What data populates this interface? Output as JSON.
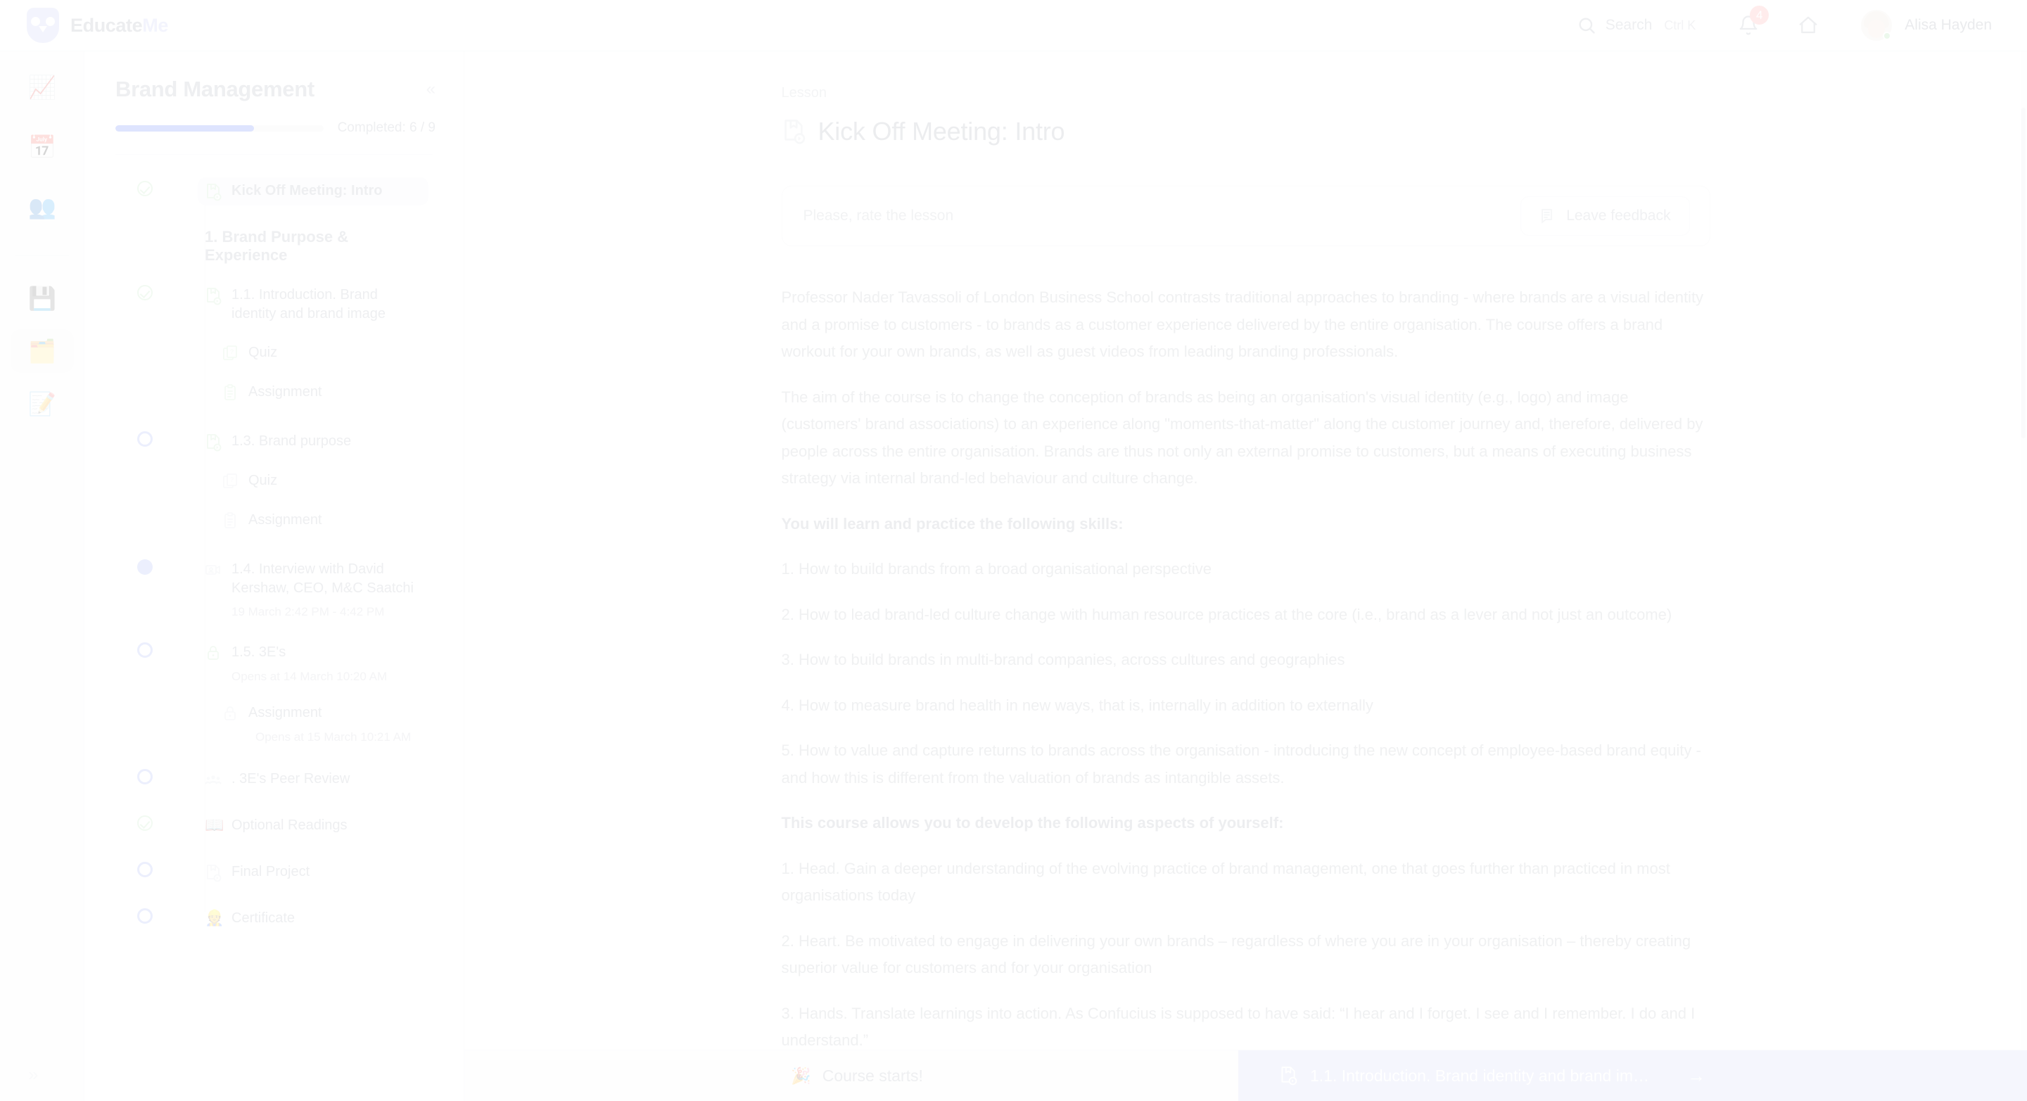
{
  "header": {
    "brand_first": "Educate",
    "brand_second": "Me",
    "brand_icon": "owl-logo",
    "search_label": "Search",
    "search_shortcut": "Ctrl K",
    "search_icon": "search-icon",
    "notifications_icon": "bell-icon",
    "notifications_count": "4",
    "home_icon": "home-icon",
    "user_name": "Alisa Hayden",
    "avatar_icon": "avatar",
    "online_status": "online"
  },
  "rail": {
    "expand_icon": "chevron-double-right-icon",
    "items": [
      {
        "name": "analytics",
        "icon": "chart-increasing-icon",
        "glyph": "📈",
        "selected": false
      },
      {
        "name": "calendar",
        "icon": "calendar-icon",
        "glyph": "📅",
        "selected": false
      },
      {
        "name": "people",
        "icon": "people-icon",
        "glyph": "👥",
        "selected": false
      },
      {
        "name": "saved",
        "icon": "floppy-disk-icon",
        "glyph": "💾",
        "selected": false
      },
      {
        "name": "courses",
        "icon": "card-index-dividers-icon",
        "glyph": "🗂️",
        "selected": true
      },
      {
        "name": "notes",
        "icon": "memo-icon",
        "glyph": "📝",
        "selected": false
      }
    ]
  },
  "course": {
    "title": "Brand Management",
    "collapse_icon": "chevron-double-left-icon",
    "progress_label": "Completed: 6 / 9",
    "progress_completed": 6,
    "progress_total": 9,
    "progress_percent": 66.6,
    "progress_color": "#3b5bfd",
    "items": [
      {
        "label": "Kick Off Meeting: Intro",
        "icon": "lesson-video-icon",
        "marker": "done",
        "active": true,
        "bold": true,
        "sub": "",
        "indent": false
      },
      {
        "label": "1. Brand Purpose & Experience",
        "icon": "none",
        "marker": "none",
        "active": false,
        "bold": true,
        "sub": "",
        "indent": false,
        "section": true
      },
      {
        "label": "1.1. Introduction. Brand identity and brand image",
        "icon": "lesson-video-icon",
        "marker": "done",
        "active": false,
        "bold": false,
        "sub": "",
        "indent": false
      },
      {
        "label": "Quiz",
        "icon": "quiz-icon",
        "marker": "none",
        "active": false,
        "bold": false,
        "sub": "",
        "indent": true
      },
      {
        "label": "Assignment",
        "icon": "assignment-icon",
        "marker": "none",
        "active": false,
        "bold": false,
        "sub": "",
        "indent": true
      },
      {
        "label": "1.3. Brand purpose",
        "icon": "lesson-video-icon",
        "marker": "open",
        "active": false,
        "bold": false,
        "sub": "",
        "indent": false
      },
      {
        "label": "Quiz",
        "icon": "quiz-icon",
        "marker": "none",
        "active": false,
        "bold": false,
        "sub": "",
        "indent": true
      },
      {
        "label": "Assignment",
        "icon": "assignment-icon",
        "marker": "none",
        "active": false,
        "bold": false,
        "sub": "",
        "indent": true
      },
      {
        "label": "1.4. Interview with David Kershaw, CEO, M&C Saatchi",
        "icon": "interview-video-icon",
        "marker": "current",
        "active": false,
        "bold": false,
        "sub": "19 March 2:42 PM - 4:42 PM",
        "indent": false
      },
      {
        "label": "1.5. 3E's",
        "icon": "lock-green-icon",
        "marker": "open",
        "active": false,
        "bold": false,
        "sub": "Opens at 14 March 10:20 AM",
        "indent": false
      },
      {
        "label": "Assignment",
        "icon": "lock-icon",
        "marker": "none",
        "active": false,
        "bold": false,
        "sub": "Opens at 15 March 10:21 AM",
        "indent": true
      },
      {
        "label": ". 3E's Peer Review",
        "icon": "peer-review-icon",
        "marker": "open",
        "active": false,
        "bold": false,
        "sub": "",
        "indent": false
      },
      {
        "label": "Optional Readings",
        "icon": "open-book-icon",
        "marker": "done",
        "active": false,
        "bold": false,
        "sub": "",
        "indent": false
      },
      {
        "label": "Final Project",
        "icon": "lesson-video-icon",
        "marker": "open",
        "active": false,
        "bold": false,
        "sub": "",
        "indent": false
      },
      {
        "label": "Certificate",
        "icon": "certificate-person-icon",
        "marker": "open",
        "active": false,
        "bold": false,
        "sub": "",
        "indent": false
      }
    ]
  },
  "lesson": {
    "eyebrow": "Lesson",
    "title": "Kick Off Meeting: Intro",
    "title_icon": "lesson-video-icon",
    "rate_prompt": "Please, rate the lesson",
    "feedback_label": "Leave feedback",
    "feedback_icon": "feedback-note-icon",
    "paragraphs": [
      {
        "text": "Professor Nader Tavassoli of London Business School contrasts traditional approaches to branding - where brands are a visual identity and a promise to customers - to brands as a customer experience delivered by the entire organisation. The course offers a brand workout for your own brands, as well as guest videos from leading branding professionals.",
        "strong": false
      },
      {
        "text": "The aim of the course is to change the conception of brands as being an organisation's visual identity (e.g., logo) and image (customers' brand associations) to an experience along \"moments-that-matter\" along the customer journey and, therefore, delivered by people across the entire organisation. Brands are thus not only an external promise to customers, but a means of executing business strategy via internal brand-led behaviour and culture change.",
        "strong": false
      },
      {
        "text": "You will learn and practice the following skills:",
        "strong": true
      },
      {
        "text": "1. How to build brands from a broad organisational perspective",
        "strong": false
      },
      {
        "text": "2. How to lead brand-led culture change with human resource practices at the core (i.e., brand as a lever and not just an outcome)",
        "strong": false
      },
      {
        "text": "3. How to build brands in multi-brand companies, across cultures and geographies",
        "strong": false
      },
      {
        "text": "4. How to measure brand health in new ways, that is, internally in addition to externally",
        "strong": false
      },
      {
        "text": "5. How to value and capture returns to brands across the organisation - introducing the new concept of employee-based brand equity - and how this is different from the valuation of brands as intangible assets.",
        "strong": false
      },
      {
        "text": "This course allows you to develop the following aspects of yourself:",
        "strong": true
      },
      {
        "text": "1. Head. Gain a deeper understanding of the evolving practice of brand management, one that goes further than practiced in most organisations today",
        "strong": false
      },
      {
        "text": "2. Heart. Be motivated to engage in delivering your own brands – regardless of where you are in your organisation – thereby creating superior value for customers and for your organisation",
        "strong": false
      },
      {
        "text": "3. Hands. Translate learnings into action. As Confucius is supposed to have said: “I hear and I forget. I see and I remember. I do and I understand.”",
        "strong": false
      }
    ]
  },
  "footer": {
    "course_starts_label": "Course starts!",
    "course_starts_icon": "party-popper-icon",
    "course_starts_glyph": "🎉",
    "next_label": "1.1. Introduction. Brand identity and brand im…",
    "next_icon": "lesson-video-icon",
    "next_arrow_icon": "arrow-right-icon",
    "next_button_color": "#c3cbf5"
  }
}
